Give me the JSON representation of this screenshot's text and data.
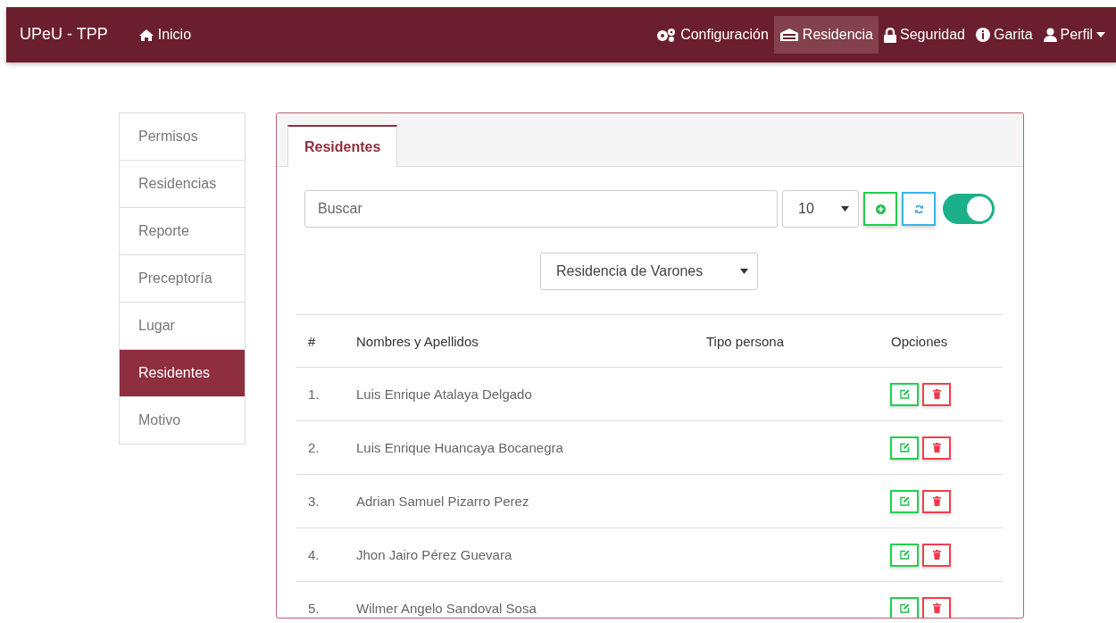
{
  "navbar": {
    "brand": "UPeU - TPP",
    "home": {
      "label": "Inicio",
      "kind": "home"
    },
    "items": [
      {
        "label": "Configuración",
        "kind": "gears",
        "selected": false
      },
      {
        "label": "Residencia",
        "kind": "building",
        "selected": true
      },
      {
        "label": "Seguridad",
        "kind": "lock",
        "selected": false
      },
      {
        "label": "Garita",
        "kind": "circle",
        "selected": false
      },
      {
        "label": "Perfil",
        "kind": "user",
        "selected": false,
        "dropdown": true
      }
    ]
  },
  "sidebar": {
    "items": [
      {
        "label": "Permisos",
        "selected": false
      },
      {
        "label": "Residencias",
        "selected": false
      },
      {
        "label": "Reporte",
        "selected": false
      },
      {
        "label": "Preceptoría",
        "selected": false
      },
      {
        "label": "Lugar",
        "selected": false
      },
      {
        "label": "Residentes",
        "selected": true
      },
      {
        "label": "Motivo",
        "selected": false
      }
    ]
  },
  "tabs": [
    {
      "label": "Residentes",
      "selected": true
    }
  ],
  "search": {
    "placeholder": "Buscar"
  },
  "page_size": "10",
  "toggle": {
    "on": true
  },
  "residence_select": "Residencia de Varones",
  "table": {
    "columns": [
      "#",
      "Nombres y Apellidos",
      "Tipo persona",
      "Opciones"
    ],
    "rows": [
      {
        "index": "1.",
        "name": "Luis Enrique Atalaya Delgado"
      },
      {
        "index": "2.",
        "name": "Luis Enrique Huancaya Bocanegra"
      },
      {
        "index": "3.",
        "name": "Adrian Samuel Pizarro Perez"
      },
      {
        "index": "4.",
        "name": "Jhon Jairo Pérez Guevara"
      },
      {
        "index": "5.",
        "name": "Wilmer Angelo Sandoval Sosa"
      }
    ]
  }
}
